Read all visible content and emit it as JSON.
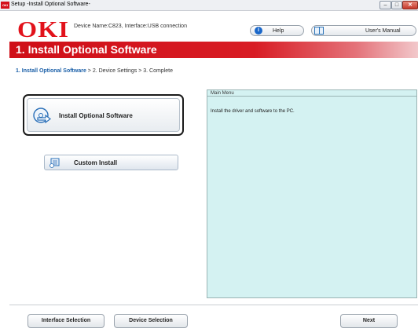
{
  "window": {
    "app_icon_text": "OKI",
    "title": "Setup -Install Optional Software-",
    "controls": {
      "minimize": "–",
      "maximize": "□",
      "close": "✕"
    }
  },
  "header": {
    "logo": "OKI",
    "device_info": "Device Name:C823, Interface:USB connection",
    "help_label": "Help",
    "help_icon_glyph": "i",
    "manual_label": "User's Manual"
  },
  "banner": {
    "title": "1. Install Optional Software"
  },
  "breadcrumb": {
    "current": "1. Install Optional Software",
    "rest": " > 2. Device Settings > 3. Complete"
  },
  "actions": {
    "install_optional": "Install Optional Software",
    "custom_install": "Custom Install"
  },
  "info_panel": {
    "tab": "Main Menu",
    "text": "Install the driver and software to the PC."
  },
  "footer": {
    "interface_selection": "Interface Selection",
    "device_selection": "Device Selection",
    "next": "Next"
  },
  "colors": {
    "brand_red": "#e2121b",
    "banner_red": "#cf0f18",
    "breadcrumb_blue": "#1a5fa8",
    "panel_bg": "#d4f2f2"
  }
}
